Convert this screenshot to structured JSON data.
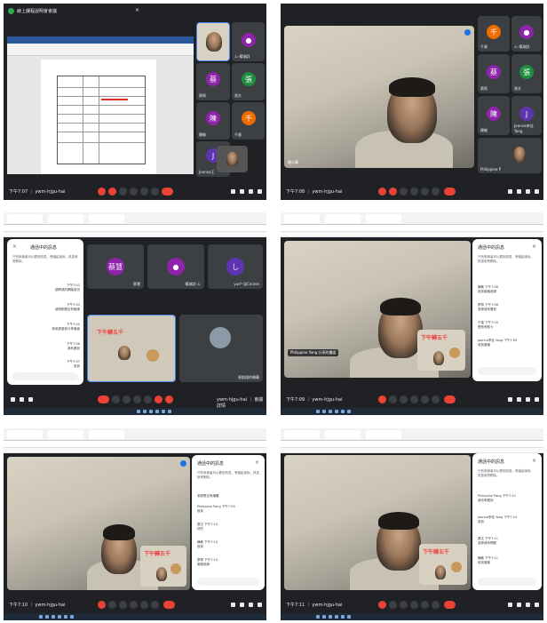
{
  "shot1": {
    "window_title": "線上課程說明會會議",
    "time_label": "下午7:07",
    "meeting_label": "ywm-hjgu-hai",
    "participants": [
      {
        "initial": "",
        "name": "",
        "color": "#8e24aa"
      },
      {
        "initial": "",
        "name": "ㄙ-楊瑞詳",
        "color": "#8e24aa"
      },
      {
        "initial": "蔡",
        "name": "蔡佩",
        "color": "#8e24aa"
      },
      {
        "initial": "張",
        "name": "張文",
        "color": "#1e8e3e"
      },
      {
        "initial": "陳",
        "name": "陳敏",
        "color": "#8e24aa"
      },
      {
        "initial": "千",
        "name": "千歲",
        "color": "#ef6c00"
      },
      {
        "initial": "J",
        "name": "Joanna王",
        "color": "#5e35b1"
      }
    ]
  },
  "shot2": {
    "time_label": "下午7:08",
    "meeting_label": "ywm-hjgu-hai",
    "self_label": "陳小華",
    "participants": [
      {
        "initial": "千",
        "name": "千歲",
        "color": "#ef6c00"
      },
      {
        "initial": "",
        "name": "ㄙ-楊瑞詳",
        "color": "#8e24aa"
      },
      {
        "initial": "蔡",
        "name": "蔡佩",
        "color": "#8e24aa"
      },
      {
        "initial": "張",
        "name": "張文",
        "color": "#1e8e3e"
      },
      {
        "initial": "陳",
        "name": "陳敏",
        "color": "#8e24aa"
      },
      {
        "initial": "J",
        "name": "Joanna李佳 Yang",
        "color": "#5e35b1"
      },
      {
        "initial": "",
        "name": "Philippine P",
        "color": "#3c4043"
      }
    ]
  },
  "shot3": {
    "panel_title": "通話中的訊息",
    "panel_intro": "只有參與者可以看到訊息，會議結束後，訊息就會刪除。",
    "messages": [
      {
        "time": "下午7:01",
        "text": "請問我的網路狀況"
      },
      {
        "time": "下午7:03",
        "text": "我剛剛是否有斷線"
      },
      {
        "time": "下午7:05",
        "text": "請老師重新分享畫面"
      },
      {
        "time": "下午7:06",
        "text": "我有看到"
      },
      {
        "time": "下午7:07",
        "text": "收到"
      }
    ],
    "tiles": [
      {
        "initial": "蔡慧",
        "name": "蔡慧",
        "color": "#8e24aa"
      },
      {
        "initial": "",
        "name": "楊瑞詳-ㄙ",
        "color": "#8e24aa"
      },
      {
        "initial": "し",
        "name": "yue*-吳Connie",
        "color": "#5e35b1"
      }
    ],
    "poster_text": "下午轉五千",
    "footer_right": "ywm-hjgu-hai ｜ 會議詳情",
    "caption": "張凱翔的螢幕"
  },
  "shot4": {
    "panel_title": "通話中的訊息",
    "panel_intro": "只有參與者可以看到訊息，會議結束後，訊息就會刪除。",
    "messages": [
      {
        "sender": "陳敏",
        "time": "下午7:08",
        "text": "收到謝謝老師"
      },
      {
        "sender": "蔡佩",
        "time": "下午7:08",
        "text": "老師我有看到"
      },
      {
        "sender": "千歲",
        "time": "下午7:09",
        "text": "聲音有點卡"
      },
      {
        "sender": "Joanna李佳 Yang",
        "time": "下午7:09",
        "text": "收到謝謝"
      }
    ],
    "poster_text": "下午轉五千",
    "chip_label": "Philippine Yang 分享的畫面",
    "time_label": "下午7:09",
    "meeting_label": "ywm-hjgu-hai"
  },
  "shot5": {
    "panel_title": "通話中的訊息",
    "panel_intro": "只有參與者可以看到訊息，會議結束後，訊息就會刪除。",
    "messages": [
      {
        "sender": "",
        "time": "",
        "text": "老師是否有講義"
      },
      {
        "sender": "Philippine Pang",
        "time": "下午7:09",
        "text": "收到"
      },
      {
        "sender": "張文",
        "time": "下午7:10",
        "text": "好的"
      },
      {
        "sender": "陳敏",
        "time": "下午7:10",
        "text": "收到"
      },
      {
        "sender": "蔡佩",
        "time": "下午7:10",
        "text": "謝謝老師"
      }
    ],
    "poster_text": "下午轉五千",
    "time_label": "下午7:10",
    "meeting_label": "ywm-hjgu-hai"
  },
  "shot6": {
    "panel_title": "通話中的訊息",
    "panel_intro": "只有參與者可以看到訊息，會議結束後，訊息就會刪除。",
    "messages": [
      {
        "sender": "Philippine Pang",
        "time": "下午7:10",
        "text": "我也有看到"
      },
      {
        "sender": "Joanna李佳 Yang",
        "time": "下午7:10",
        "text": "收到"
      },
      {
        "sender": "張文",
        "time": "下午7:11",
        "text": "老師我有問題"
      },
      {
        "sender": "陳敏",
        "time": "下午7:11",
        "text": "收到謝謝"
      }
    ],
    "poster_text": "下午轉五千",
    "time_label": "下午7:11",
    "meeting_label": "ywm-hjgu-hai"
  }
}
